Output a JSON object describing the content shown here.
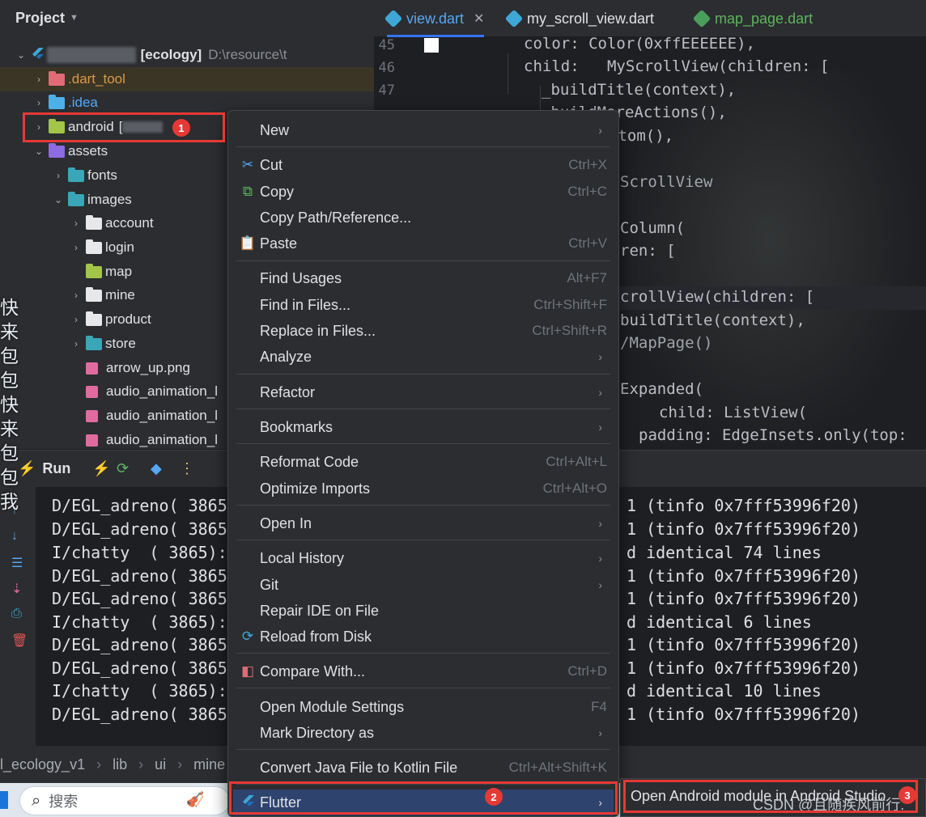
{
  "project_panel": {
    "title": "Project",
    "root": {
      "label_blurred": "tu_ecology_v1",
      "module": "[ecology]",
      "path": "D:\\resource\\t"
    },
    "items": [
      {
        "label": "dart_tool",
        "prefix": ".",
        "color": "orange"
      },
      {
        "label": "idea",
        "prefix": ".",
        "color": "blue"
      },
      {
        "label": "android",
        "suffix": "["
      },
      {
        "label": "assets"
      },
      {
        "label": "fonts"
      },
      {
        "label": "images"
      },
      {
        "label": "account"
      },
      {
        "label": "login"
      },
      {
        "label": "map"
      },
      {
        "label": "mine"
      },
      {
        "label": "product"
      },
      {
        "label": "store"
      },
      {
        "label": "arrow_up.png"
      },
      {
        "label": "audio_animation_l"
      },
      {
        "label": "audio_animation_l"
      },
      {
        "label": "audio_animation_l"
      }
    ]
  },
  "editor": {
    "tabs": [
      {
        "label": "view.dart"
      },
      {
        "label": "my_scroll_view.dart"
      },
      {
        "label": "map_page.dart"
      }
    ],
    "line_numbers": [
      "45",
      "46",
      "47"
    ],
    "lines": [
      "color: Color(0xffEEEEEE),",
      "child:   MyScrollView(children: [",
      "_buildTitle(context),",
      "_buildMoreActions(),",
      "ttom(),",
      ")",
      "ScrollView",
      "Column(",
      "ren: [",
      "crollView(children: [",
      "buildTitle(context),",
      "/MapPage()",
      "Expanded(",
      "child: ListView(",
      "padding: EdgeInsets.only(top:"
    ]
  },
  "run_panel": {
    "title": "Run",
    "log_left": [
      "D/EGL_adreno( 3865",
      "D/EGL_adreno( 3865",
      "I/chatty  ( 3865):",
      "D/EGL_adreno( 3865",
      "D/EGL_adreno( 3865",
      "I/chatty  ( 3865):",
      "D/EGL_adreno( 3865",
      "D/EGL_adreno( 3865",
      "I/chatty  ( 3865):",
      "D/EGL_adreno( 3865"
    ],
    "log_right": [
      "1 (tinfo 0x7fff53996f20)",
      "1 (tinfo 0x7fff53996f20)",
      "d identical 74 lines",
      "1 (tinfo 0x7fff53996f20)",
      "1 (tinfo 0x7fff53996f20)",
      "d identical 6 lines",
      "1 (tinfo 0x7fff53996f20)",
      "1 (tinfo 0x7fff53996f20)",
      "d identical 10 lines",
      "1 (tinfo 0x7fff53996f20)"
    ]
  },
  "cjk_overlay": "快来包包快来包包我",
  "breadcrumb": [
    "l_ecology_v1",
    "lib",
    "ui",
    "mine"
  ],
  "taskbar": {
    "search_placeholder": "搜索"
  },
  "context_menu": {
    "items": [
      {
        "label": "New",
        "shortcut": "",
        "submenu": true
      },
      {
        "label": "Cut",
        "shortcut": "Ctrl+X",
        "icon": "scissors-icon"
      },
      {
        "label": "Copy",
        "shortcut": "Ctrl+C",
        "icon": "copy-icon"
      },
      {
        "label": "Copy Path/Reference...",
        "shortcut": ""
      },
      {
        "label": "Paste",
        "shortcut": "Ctrl+V",
        "icon": "clipboard-icon"
      },
      {
        "label": "Find Usages",
        "shortcut": "Alt+F7"
      },
      {
        "label": "Find in Files...",
        "shortcut": "Ctrl+Shift+F"
      },
      {
        "label": "Replace in Files...",
        "shortcut": "Ctrl+Shift+R"
      },
      {
        "label": "Analyze",
        "shortcut": "",
        "submenu": true
      },
      {
        "label": "Refactor",
        "shortcut": "",
        "submenu": true
      },
      {
        "label": "Bookmarks",
        "shortcut": "",
        "submenu": true
      },
      {
        "label": "Reformat Code",
        "shortcut": "Ctrl+Alt+L"
      },
      {
        "label": "Optimize Imports",
        "shortcut": "Ctrl+Alt+O"
      },
      {
        "label": "Open In",
        "shortcut": "",
        "submenu": true
      },
      {
        "label": "Local History",
        "shortcut": "",
        "submenu": true
      },
      {
        "label": "Git",
        "shortcut": "",
        "submenu": true
      },
      {
        "label": "Repair IDE on File",
        "shortcut": ""
      },
      {
        "label": "Reload from Disk",
        "shortcut": "",
        "icon": "reload-icon"
      },
      {
        "label": "Compare With...",
        "shortcut": "Ctrl+D",
        "icon": "compare-icon"
      },
      {
        "label": "Open Module Settings",
        "shortcut": "F4"
      },
      {
        "label": "Mark Directory as",
        "shortcut": "",
        "submenu": true
      },
      {
        "label": "Convert Java File to Kotlin File",
        "shortcut": "Ctrl+Alt+Shift+K"
      },
      {
        "label": "Flutter",
        "shortcut": "",
        "submenu": true,
        "icon": "flutter-icon"
      }
    ]
  },
  "submenu": {
    "label": "Open Android module in Android Studio"
  },
  "watermark": "CSDN @且随疾风前行.",
  "annotations": {
    "badge1": "1",
    "badge2": "2",
    "badge3": "3"
  },
  "colors": {
    "accent": "#3574f0",
    "annotation_red": "#e53935",
    "menu_highlight": "#2e436e"
  }
}
